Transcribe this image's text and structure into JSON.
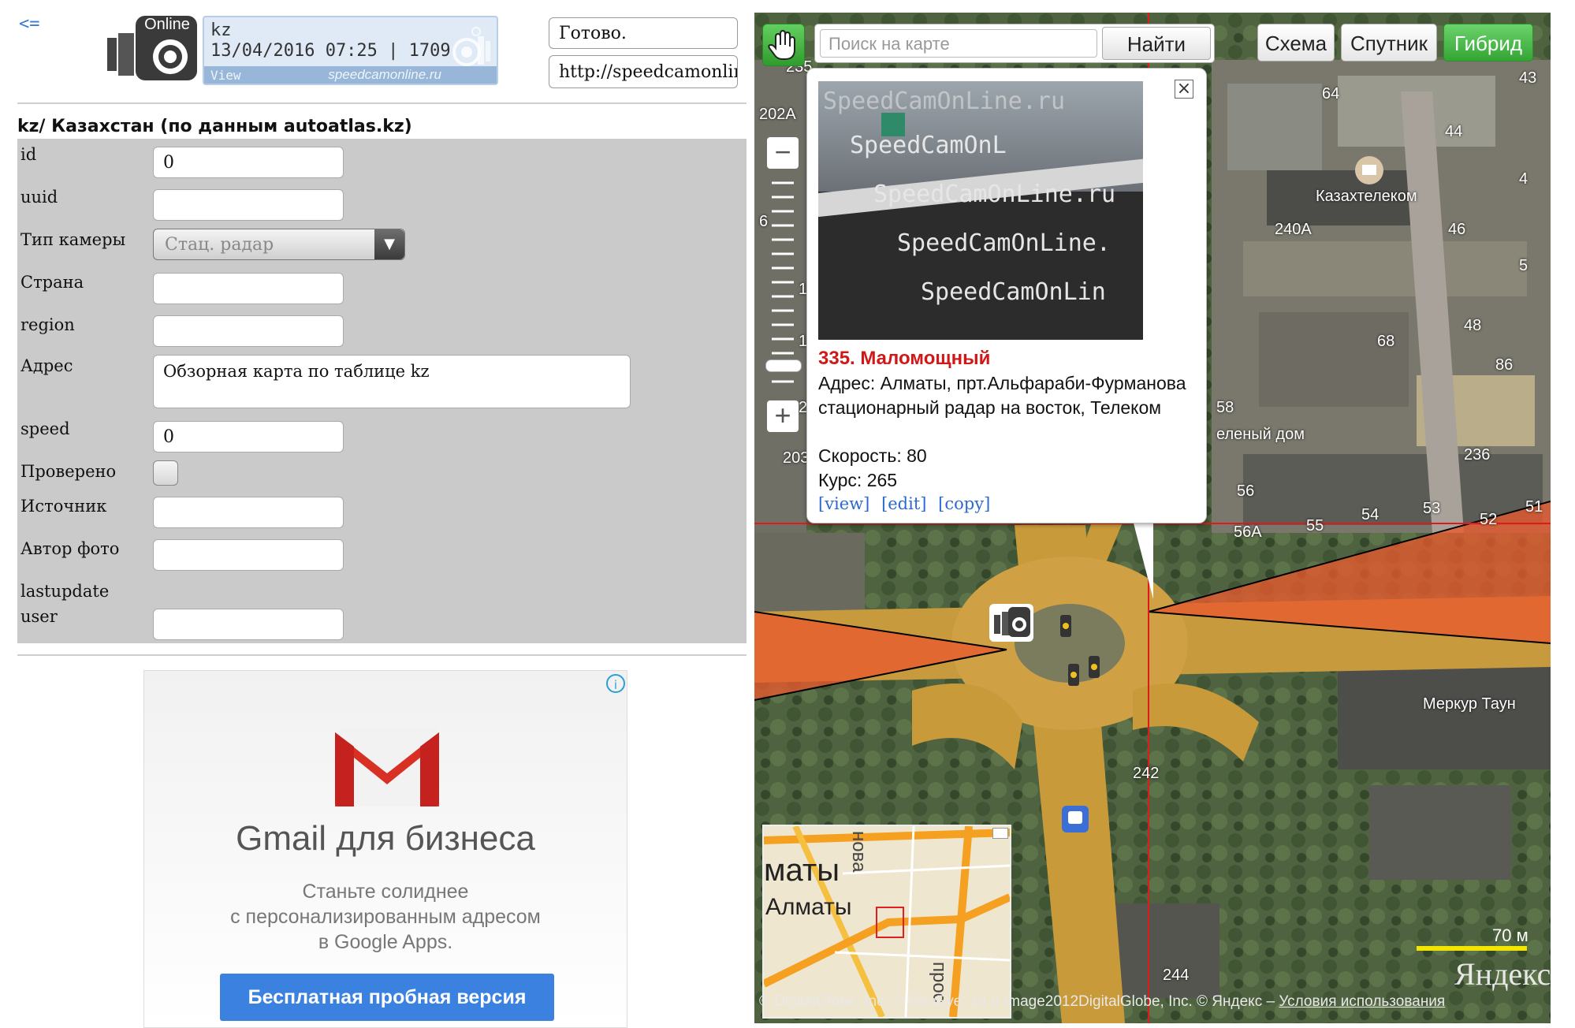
{
  "header": {
    "back_link": "<=",
    "banner_line1": "kz",
    "banner_line2": "13/04/2016 07:25 | 1709",
    "banner_view": "View",
    "banner_site": "speedcamonline.ru",
    "logo_badge": "Online",
    "status_text": "Готово.",
    "url_text": "http://speedcamonline.ru"
  },
  "form": {
    "title": "kz/ Казахстан (по данным autoatlas.kz)",
    "fields": [
      {
        "label": "id",
        "value": "0"
      },
      {
        "label": "uuid",
        "value": ""
      },
      {
        "label": "Тип камеры",
        "value": "Стац. радар"
      },
      {
        "label": "Страна",
        "value": ""
      },
      {
        "label": "region",
        "value": ""
      },
      {
        "label": "Адрес",
        "value": "Обзорная карта по таблице kz"
      },
      {
        "label": "speed",
        "value": "0"
      },
      {
        "label": "Проверено",
        "value": ""
      },
      {
        "label": "Источник",
        "value": ""
      },
      {
        "label": "Автор фото",
        "value": ""
      },
      {
        "label": "lastupdate",
        "value": ""
      },
      {
        "label": "user",
        "value": ""
      }
    ]
  },
  "ad": {
    "info_icon": "i",
    "headline": "Gmail для бизнеса",
    "body_line1": "Станьте солиднее",
    "body_line2": "с персонализированным адресом",
    "body_line3": "в Google Apps.",
    "cta": "Бесплатная пробная версия"
  },
  "map": {
    "search_placeholder": "Поиск на карте",
    "search_button": "Найти",
    "layer_buttons": [
      "Схема",
      "Спутник",
      "Гибрид"
    ],
    "active_layer": "Гибрид",
    "zoom_minus": "−",
    "zoom_plus": "+",
    "popup": {
      "close": "×",
      "photo_watermarks": [
        "SpeedCamOnLine.ru",
        "SpeedCamOnL",
        "SpeedCamOnLine.ru",
        "SpeedCamOnLine.",
        "SpeedCamOnLin"
      ],
      "title": "335. Маломощный",
      "address": "Адрес: Алматы, прт.Альфараби-Фурманова стационарный радар на восток, Телеком",
      "speed": "Скорость: 80",
      "course": "Курс: 265",
      "links": [
        "[view]",
        "[edit]",
        "[copy]"
      ]
    },
    "labels": {
      "l64": "64",
      "l44": "44",
      "kaztelecom": "Казахтелеком",
      "l240a": "240А",
      "l46": "46",
      "l48": "48",
      "l56": "56",
      "l54": "54",
      "l53": "53",
      "l52": "52",
      "l51": "51",
      "l56a": "56А",
      "l55": "55",
      "green_house": "еленый дом",
      "merkur": "Меркур Таун",
      "l242": "242",
      "l244": "244",
      "l202a": "202А",
      "l235": "235",
      "l43": "43",
      "l203": "203",
      "l199": "199",
      "l197": "197",
      "l6": "6",
      "l4": "4",
      "l5": "5",
      "l58": "58",
      "l68": "68",
      "l86": "86",
      "l201": "201",
      "l236": "236"
    },
    "minimap": {
      "label_big": "маты",
      "label_small": "Алматы",
      "label_street1": "нова",
      "label_street2": "прос"
    },
    "scale": "70 м",
    "logo": "Яндекс",
    "copyright": "© DigitalGlobe, Inc. © GeoEye, 14.0 Image2012DigitalGlobe, Inc. © Яндекс",
    "terms": "Условия использования"
  },
  "colors": {
    "accent_green": "#34a534",
    "popup_title_red": "#d01818",
    "link_blue": "#2c6ad0",
    "form_panel_gray": "#cacaca",
    "ad_cta_blue": "#3b82e0",
    "sector_orange": "#e85a2e"
  }
}
